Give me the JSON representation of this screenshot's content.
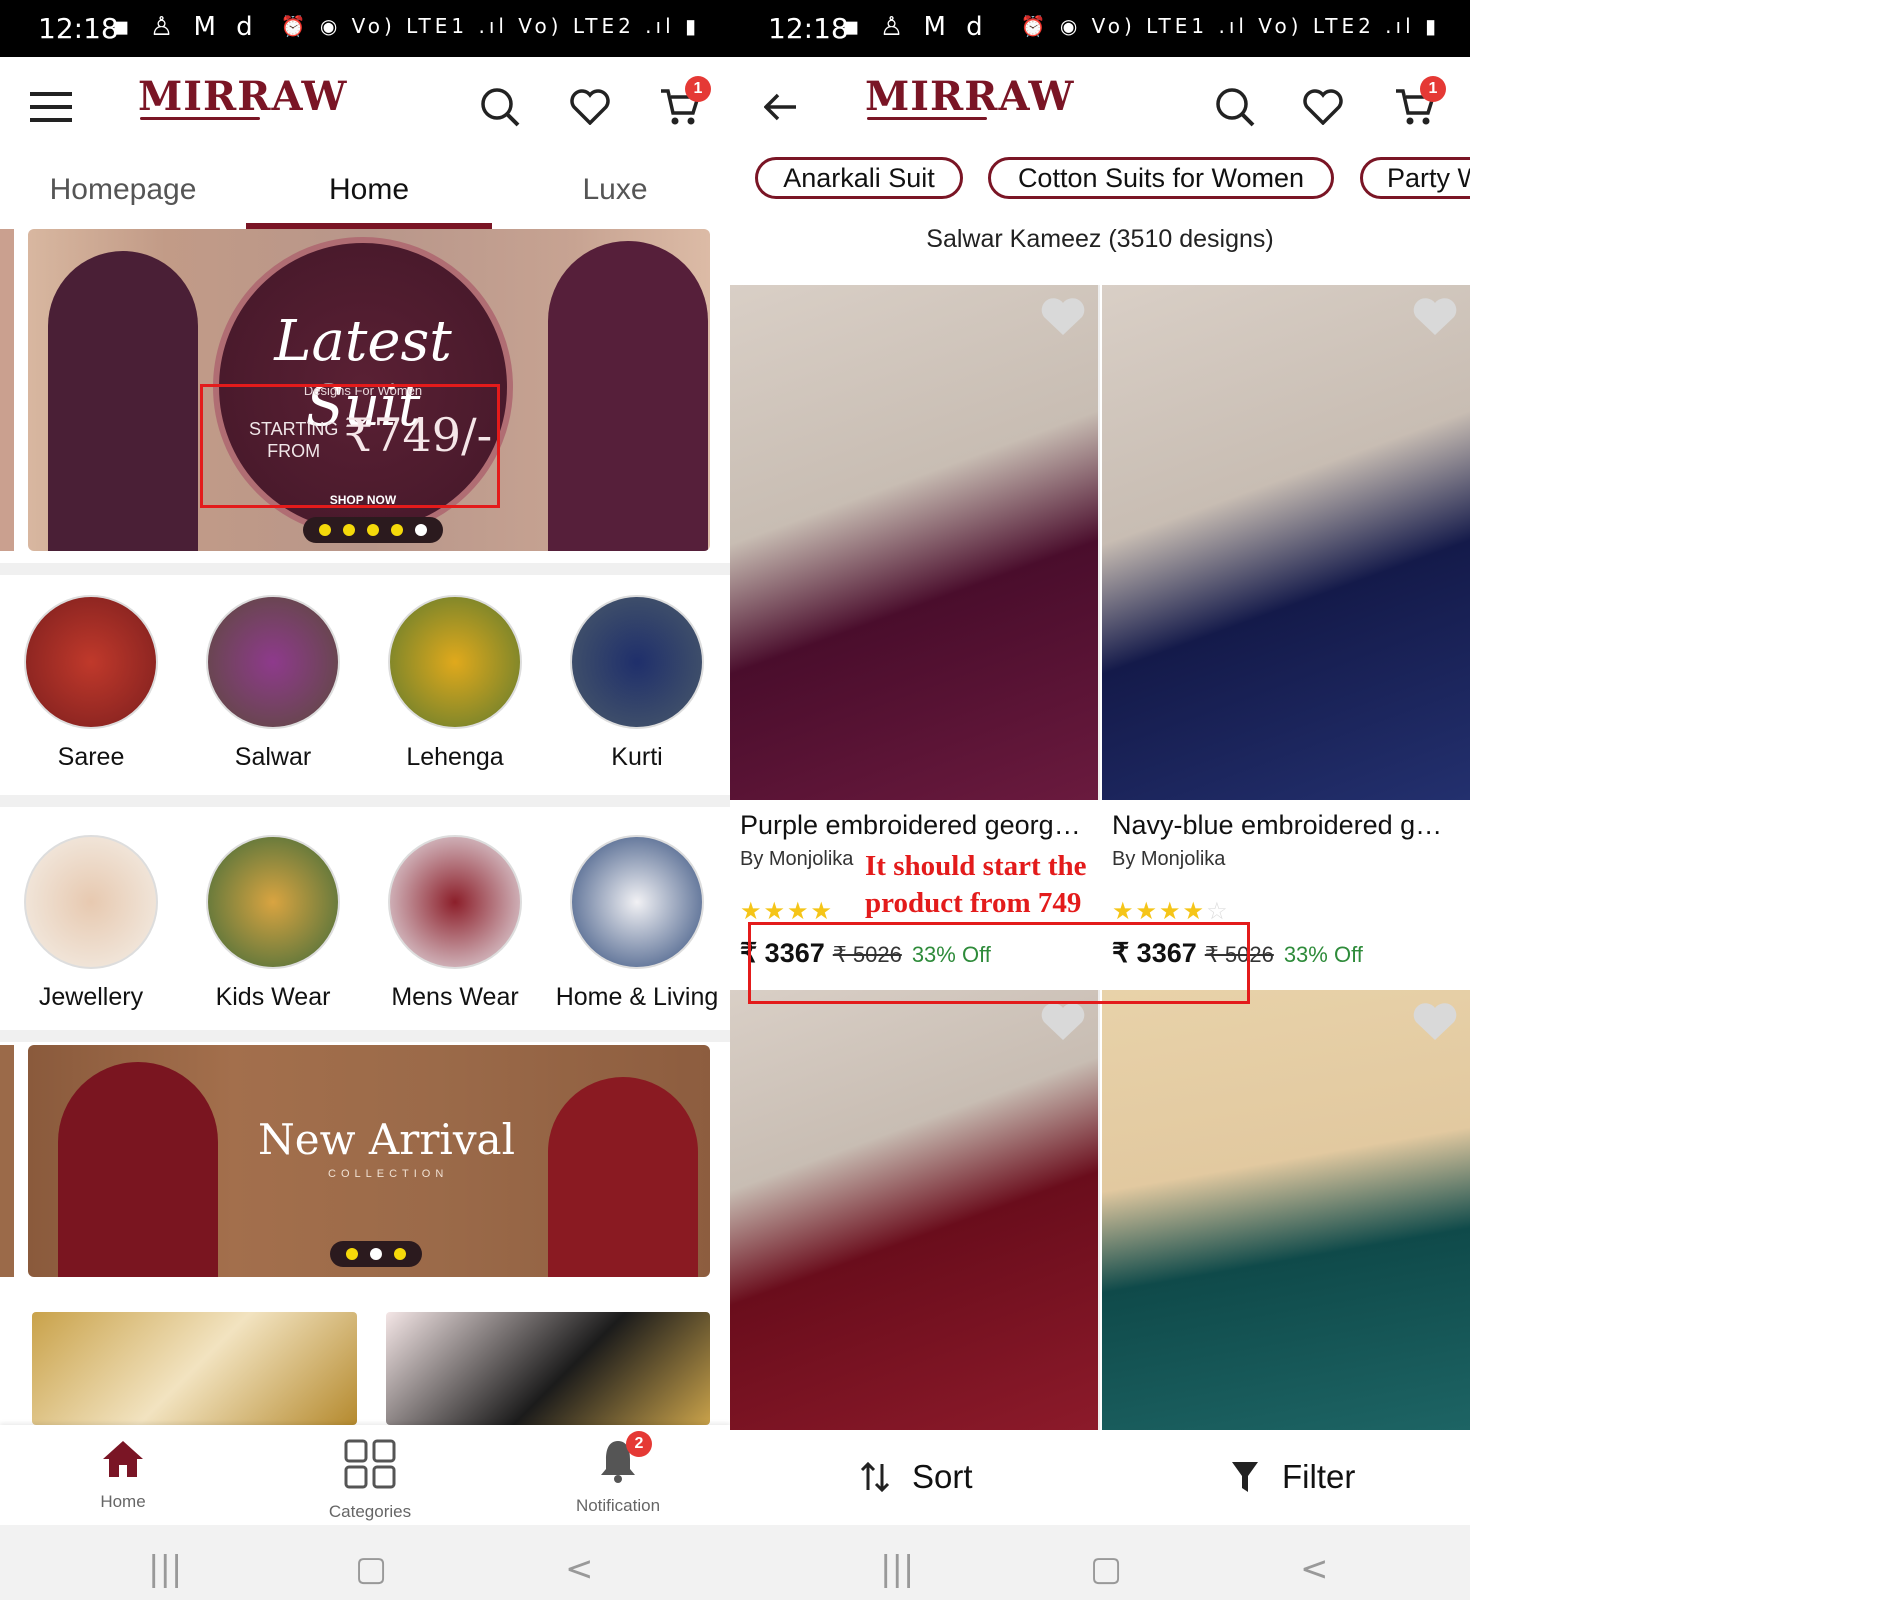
{
  "status_bar": {
    "time": "12:18",
    "left_icons": "▪ ♙ M d",
    "right_icons": "⏰ ◉ Vo) LTE1 .ıl Vo) LTE2 .ıl ▮"
  },
  "brand": {
    "logo_text": "MIRRAW",
    "accent_color": "#7a1525"
  },
  "left_screen": {
    "cart_count": "1",
    "tabs": [
      {
        "label": "Homepage"
      },
      {
        "label": "Home"
      },
      {
        "label": "Luxe"
      }
    ],
    "active_tab": "Home",
    "banner1": {
      "title": "Latest Suit",
      "subtitle": "Designs For Women",
      "starting_line1": "STARTING",
      "starting_line2": "FROM",
      "price": "₹749/-",
      "cta": "SHOP NOW"
    },
    "categories_row1": [
      {
        "label": "Saree"
      },
      {
        "label": "Salwar"
      },
      {
        "label": "Lehenga"
      },
      {
        "label": "Kurti"
      }
    ],
    "categories_row2": [
      {
        "label": "Jewellery"
      },
      {
        "label": "Kids Wear"
      },
      {
        "label": "Mens Wear"
      },
      {
        "label": "Home & Living"
      }
    ],
    "banner2": {
      "title": "New Arrival",
      "subtitle": "COLLECTION"
    },
    "bottom_nav": [
      {
        "label": "Home",
        "icon": "home-icon"
      },
      {
        "label": "Categories",
        "icon": "grid-icon"
      },
      {
        "label": "Notification",
        "icon": "bell-icon"
      }
    ],
    "notification_count": "2"
  },
  "right_screen": {
    "cart_count": "1",
    "chips": [
      {
        "label": "Anarkali Suit"
      },
      {
        "label": "Cotton Suits for Women"
      },
      {
        "label": "Party W"
      }
    ],
    "results_title": "Salwar Kameez (3510 designs)",
    "products": [
      {
        "name": "Purple embroidered georg…",
        "brand": "By Monjolika",
        "price": "₹ 3367",
        "mrp": "₹ 5026",
        "discount": "33% Off",
        "rating": 5,
        "colors": [
          "#4a0d2c",
          "#6a1a3e"
        ]
      },
      {
        "name": "Navy-blue embroidered g…",
        "brand": "By Monjolika",
        "price": "₹ 3367",
        "mrp": "₹ 5026",
        "discount": "33% Off",
        "rating": 4.5,
        "colors": [
          "#141a4a",
          "#23306e"
        ]
      },
      {
        "colors": [
          "#6a0d1c",
          "#8c1a2a"
        ]
      },
      {
        "colors": [
          "#0f4a4a",
          "#1d6464"
        ]
      }
    ],
    "annotation_line1": "It should start the",
    "annotation_line2": "product from 749",
    "sort_label": "Sort",
    "filter_label": "Filter"
  },
  "system_nav": {
    "recents": "|||",
    "home": "▢",
    "back": "<"
  }
}
